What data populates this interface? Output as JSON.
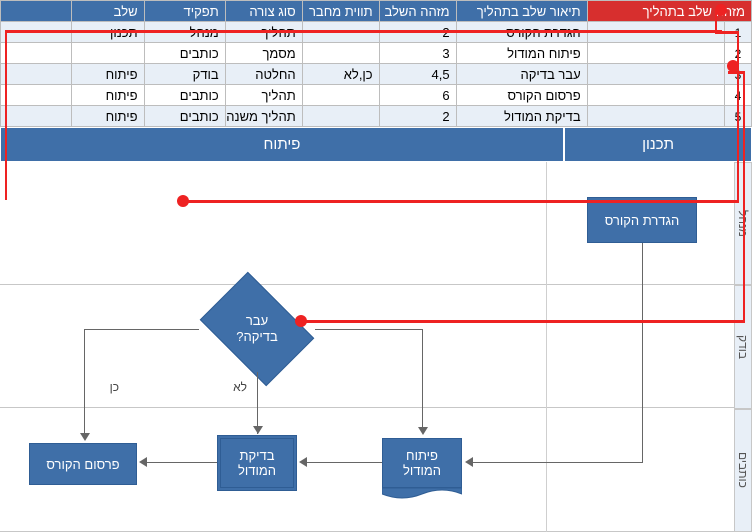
{
  "table": {
    "headers": {
      "id": "מזהה שלב בתהליך",
      "desc": "תיאור שלב בתהליך",
      "next": "מזהה השלב הבא",
      "conn": "תווית מחבר",
      "shape": "סוג צורה",
      "role": "תפקיד",
      "phase": "שלב"
    },
    "rows": [
      {
        "idx": "1",
        "desc": "הגדרת הקורס",
        "next": "2",
        "conn": "",
        "shape": "תהליך",
        "role": "מנהל",
        "phase": "תכנון"
      },
      {
        "idx": "2",
        "desc": "פיתוח המודול",
        "next": "3",
        "conn": "",
        "shape": "מסמך",
        "role": "כותבים",
        "phase": ""
      },
      {
        "idx": "3",
        "desc": "עבר בדיקה",
        "next": "4,5",
        "conn": "כן,לא",
        "shape": "החלטה",
        "role": "בודק",
        "phase": "פיתוח"
      },
      {
        "idx": "4",
        "desc": "פרסום הקורס",
        "next": "6",
        "conn": "",
        "shape": "תהליך",
        "role": "כותבים",
        "phase": "פיתוח"
      },
      {
        "idx": "5",
        "desc": "בדיקת המודול",
        "next": "2",
        "conn": "",
        "shape": "תהליך משנה",
        "role": "כותבים",
        "phase": "פיתוח"
      }
    ]
  },
  "banner": {
    "plan": "תכנון",
    "dev": "פיתוח"
  },
  "lanes": {
    "a": "מנהל",
    "b": "בודק",
    "c": "כותבים"
  },
  "flow": {
    "defCourse": "הגדרת הקורס",
    "devModule": "פיתוח\nהמודול",
    "checkModule": "בדיקת\nהמודול",
    "publish": "פרסום הקורס",
    "decision": "עבר\nבדיקה?",
    "yes": "כן",
    "no": "לא"
  }
}
